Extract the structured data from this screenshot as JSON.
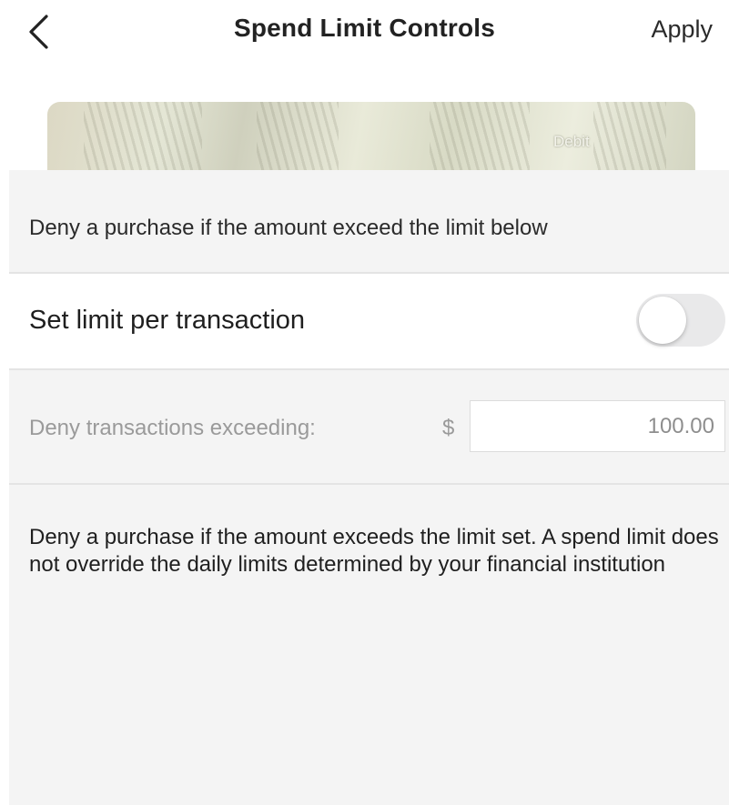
{
  "header": {
    "back_icon": "chevron-left-icon",
    "title": "Spend Limit Controls",
    "apply_label": "Apply"
  },
  "card": {
    "type_label": "Debit"
  },
  "section": {
    "header_text": "Deny a purchase if the amount exceed the limit below",
    "toggle_label": "Set limit per transaction",
    "toggle_on": false,
    "exceeding_label": "Deny transactions exceeding:",
    "currency_symbol": "$",
    "amount_value": "100.00",
    "description": "Deny a purchase if the amount exceeds the limit set. A spend limit does not override the daily limits determined by your financial institution"
  },
  "colors": {
    "panel_background": "#f4f4f4",
    "toggle_off_track": "#e9e9ea",
    "muted_text": "#9a9a9a"
  }
}
